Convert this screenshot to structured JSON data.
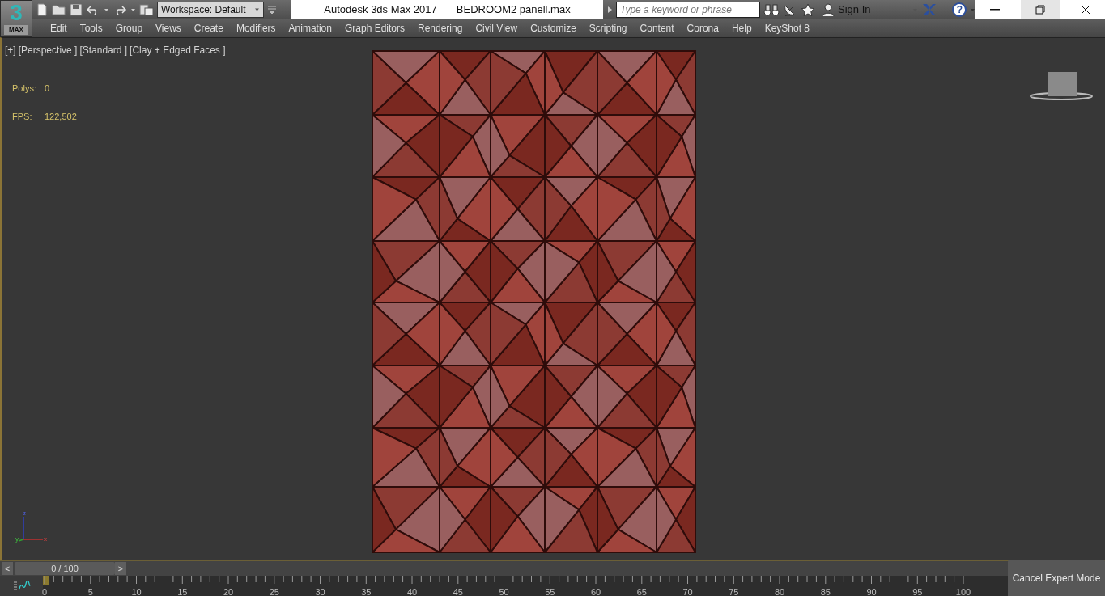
{
  "logo": {
    "mark": "3",
    "label": "MAX"
  },
  "title_bar": {
    "workspace": "Workspace: Default",
    "title": "Autodesk 3ds Max 2017",
    "file": "BEDROOM2 panell.max",
    "search": {
      "placeholder": "Type a keyword or phrase"
    },
    "sign_in": "Sign In",
    "help": "?"
  },
  "menu": [
    "Edit",
    "Tools",
    "Group",
    "Views",
    "Create",
    "Modifiers",
    "Animation",
    "Graph Editors",
    "Rendering",
    "Civil View",
    "Customize",
    "Scripting",
    "Content",
    "Corona",
    "Help",
    "KeyShot 8"
  ],
  "viewport": {
    "labels": [
      "[+]",
      "[Perspective ]",
      "[Standard ]",
      "[Clay + Edged Faces ]"
    ],
    "stats": [
      {
        "label": "Polys:",
        "value": "0"
      },
      {
        "label": "FPS:",
        "value": "122,502"
      }
    ],
    "axis_labels": [
      "z",
      "y",
      "x"
    ]
  },
  "time_slider": {
    "prev": "<",
    "reading": "0 / 100",
    "next": ">",
    "level": 0
  },
  "timeline": {
    "ticks": [
      "0",
      "5",
      "10",
      "15",
      "20",
      "25",
      "30",
      "35",
      "40",
      "45",
      "50",
      "55",
      "60",
      "65",
      "70",
      "75",
      "80",
      "85",
      "90",
      "95",
      "100"
    ]
  },
  "expert_button": "Cancel Expert Mode"
}
